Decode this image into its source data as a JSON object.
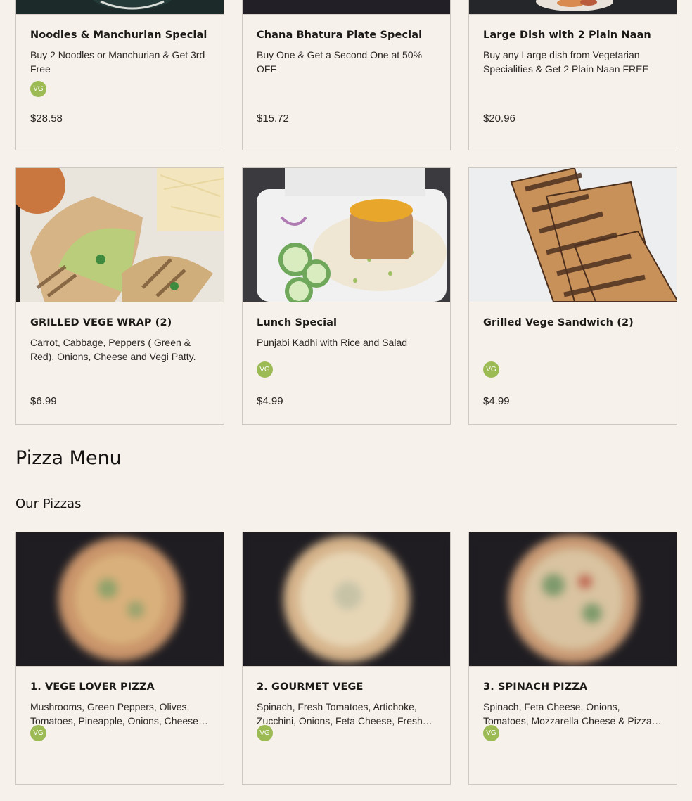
{
  "row1": [
    {
      "name": "Noodles & Manchurian Special",
      "desc": "Buy 2 Noodles or Manchurian & Get 3rd Free",
      "badge": "VG",
      "price": "$28.58"
    },
    {
      "name": "Chana Bhatura Plate Special",
      "desc": "Buy One & Get a Second One at 50% OFF",
      "badge": "",
      "price": "$15.72"
    },
    {
      "name": "Large Dish with 2 Plain Naan",
      "desc": "Buy any Large dish from Vegetarian Specialities & Get 2 Plain Naan FREE",
      "badge": "",
      "price": "$20.96"
    }
  ],
  "row2": [
    {
      "name": "GRILLED VEGE WRAP (2)",
      "desc": "Carrot, Cabbage, Peppers ( Green & Red), Onions, Cheese and Vegi Patty.",
      "badge": "",
      "price": "$6.99"
    },
    {
      "name": "Lunch Special",
      "desc": "Punjabi Kadhi with Rice and Salad",
      "badge": "VG",
      "price": "$4.99"
    },
    {
      "name": "Grilled Vege Sandwich (2)",
      "desc": "",
      "badge": "VG",
      "price": "$4.99"
    }
  ],
  "pizza_section": {
    "title": "Pizza Menu",
    "subtitle": "Our Pizzas"
  },
  "row3": [
    {
      "name": "1. VEGE LOVER PIZZA",
      "desc": "Mushrooms, Green Peppers, Olives, Tomatoes, Pineapple, Onions, Cheese & Pizza Sauce",
      "badge": "VG"
    },
    {
      "name": "2. GOURMET VEGE",
      "desc": "Spinach, Fresh Tomatoes, Artichoke, Zucchini, Onions, Feta Cheese, Fresh Garlic",
      "badge": "VG"
    },
    {
      "name": "3. SPINACH PIZZA",
      "desc": "Spinach, Feta Cheese, Onions, Tomatoes, Mozzarella Cheese & Pizza Sauce",
      "badge": "VG"
    }
  ],
  "colors": {
    "background": "#f7f1ec",
    "badge": "#9dbb55",
    "border": "#cfc8c1",
    "image_dark": "#1f1d22"
  }
}
